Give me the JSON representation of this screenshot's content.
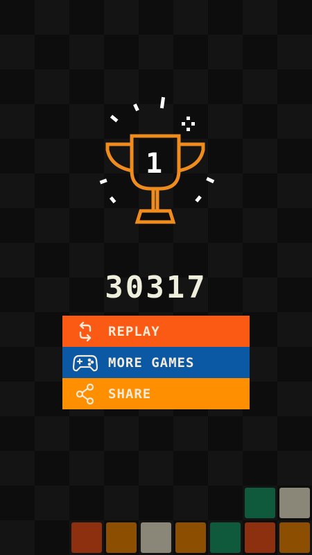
{
  "score": "30317",
  "trophy": {
    "rank": "1",
    "color": "#f08c1e"
  },
  "menu": [
    {
      "id": "replay",
      "label": "REPLAY",
      "icon": "replay-icon",
      "color": "#fa5a14"
    },
    {
      "id": "more-games",
      "label": "MORE GAMES",
      "icon": "gamepad-icon",
      "color": "#0b59a5"
    },
    {
      "id": "share",
      "label": "SHARE",
      "icon": "share-icon",
      "color": "#fe8f00"
    }
  ],
  "colors": {
    "background": "#0d0d0d",
    "score_text": "#efeedd",
    "block_green": "#0f5a3c",
    "block_gray": "#8a8778",
    "block_rust": "#8c3010",
    "block_amber": "#8c4e00"
  }
}
